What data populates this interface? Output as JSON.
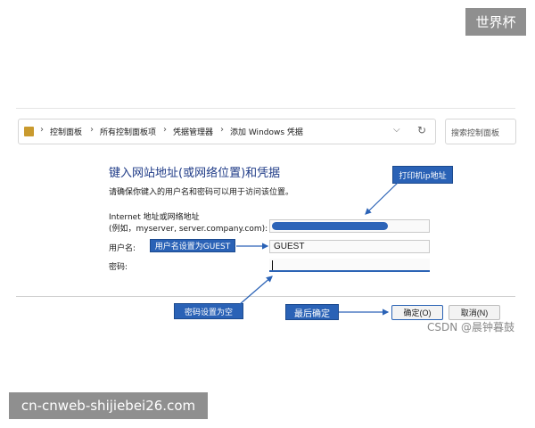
{
  "watermarks": {
    "top_tag": "世界杯",
    "bottom_tag": "cn-cnweb-shijiebei26.com",
    "csdn": "CSDN @晨钟暮鼓"
  },
  "address_bar": {
    "breadcrumbs": [
      "控制面板",
      "所有控制面板项",
      "凭据管理器",
      "添加 Windows 凭据"
    ],
    "search_placeholder": "搜索控制面板",
    "icons": [
      "folder-icon",
      "chevron-right-icon",
      "dropdown-icon",
      "refresh-icon"
    ]
  },
  "form": {
    "heading": "键入网站地址(或网络位置)和凭据",
    "subtext": "请确保你键入的用户名和密码可以用于访问该位置。",
    "address_label_line1": "Internet 地址或网络地址",
    "address_label_line2": "(例如，myserver, server.company.com):",
    "username_label": "用户名:",
    "username_value": "GUEST",
    "password_label": "密码:",
    "password_value": ""
  },
  "annotations": {
    "printer_ip": "打印机ip地址",
    "username_note": "用户名设置为GUEST",
    "password_note": "密码设置为空",
    "finally_ok": "最后确定"
  },
  "buttons": {
    "ok": "确定(O)",
    "cancel": "取消(N)"
  },
  "colors": {
    "accent": "#2a62b6",
    "heading": "#1f3b87",
    "watermark_bg": "#8f8f8f"
  }
}
